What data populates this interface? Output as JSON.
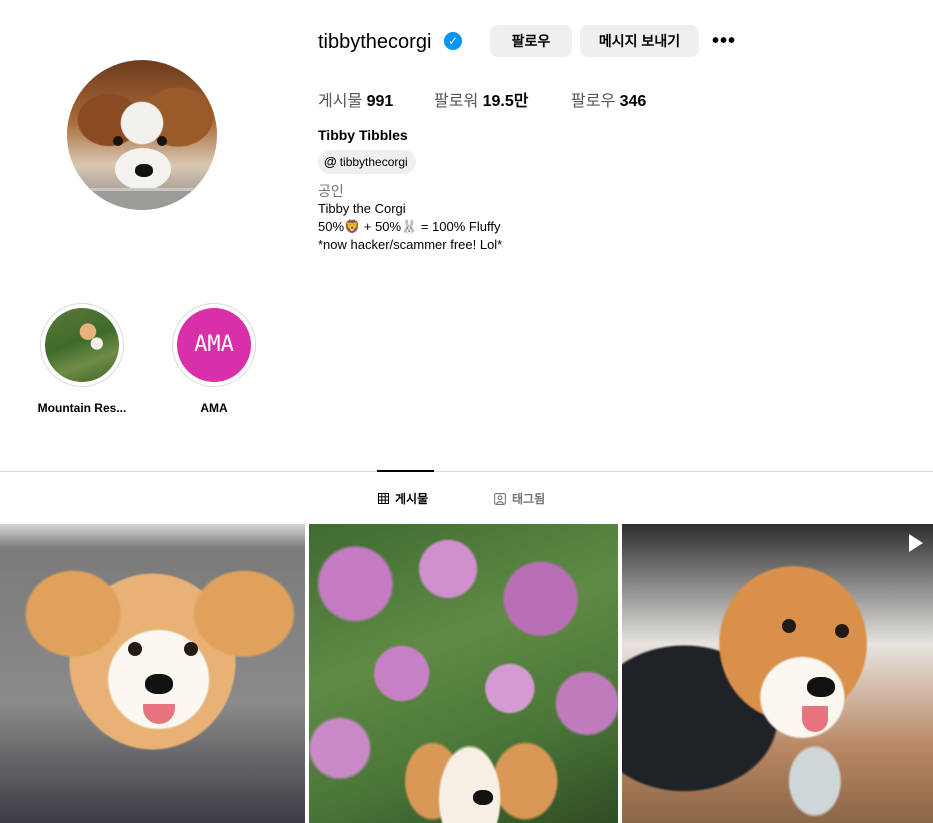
{
  "profile": {
    "username": "tibbythecorgi",
    "verified_icon": "verified-badge-icon",
    "follow_label": "팔로우",
    "message_label": "메시지 보내기",
    "more_label": "•••",
    "stats": {
      "posts_label": "게시물",
      "posts_value": "991",
      "followers_label": "팔로워",
      "followers_value": "19.5만",
      "following_label": "팔로우",
      "following_value": "346"
    },
    "full_name": "Tibby Tibbles",
    "threads_handle": "tibbythecorgi",
    "category": "공인",
    "bio": [
      "Tibby the Corgi",
      "50%🦁 + 50%🐰 = 100% Fluffy",
      "*now hacker/scammer free! Lol*"
    ]
  },
  "highlights": [
    {
      "label": "Mountain Res...",
      "cover_text": ""
    },
    {
      "label": "AMA",
      "cover_text": "AMA"
    }
  ],
  "tabs": [
    {
      "label": "게시물",
      "active": true,
      "icon": "grid-icon"
    },
    {
      "label": "태그됨",
      "active": false,
      "icon": "tagged-user-icon"
    }
  ],
  "posts": [
    {
      "type": "image"
    },
    {
      "type": "image"
    },
    {
      "type": "reel",
      "icon": "play-icon"
    }
  ],
  "colors": {
    "verified": "#0095f6",
    "button_bg": "#efefef",
    "highlight_ama": "#d92fa8",
    "muted_text": "#737373"
  }
}
